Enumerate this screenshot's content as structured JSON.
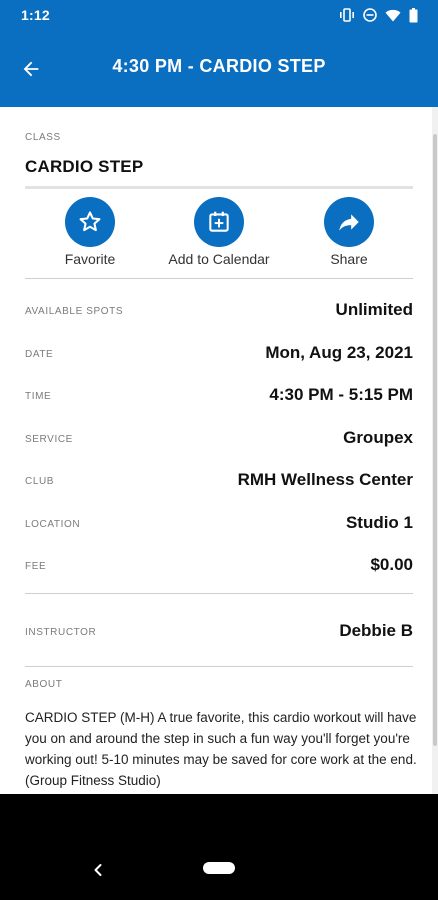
{
  "status_bar": {
    "time": "1:12",
    "icons": [
      "vibrate-icon",
      "do-not-disturb-icon",
      "wifi-icon",
      "battery-icon"
    ]
  },
  "app_bar": {
    "title": "4:30 PM - CARDIO STEP",
    "back_icon": "arrow-left-icon"
  },
  "class": {
    "label": "CLASS",
    "name": "CARDIO STEP"
  },
  "actions": [
    {
      "label": "Favorite",
      "icon": "star-outline-icon"
    },
    {
      "label": "Add to Calendar",
      "icon": "calendar-plus-icon"
    },
    {
      "label": "Share",
      "icon": "share-arrow-icon"
    }
  ],
  "details": [
    {
      "label": "AVAILABLE SPOTS",
      "value": "Unlimited"
    },
    {
      "label": "DATE",
      "value": "Mon, Aug 23, 2021"
    },
    {
      "label": "TIME",
      "value": "4:30 PM - 5:15 PM"
    },
    {
      "label": "SERVICE",
      "value": "Groupex"
    },
    {
      "label": "CLUB",
      "value": "RMH Wellness Center"
    },
    {
      "label": "LOCATION",
      "value": "Studio 1"
    },
    {
      "label": "FEE",
      "value": "$0.00"
    }
  ],
  "instructor": {
    "label": "INSTRUCTOR",
    "value": "Debbie B"
  },
  "about": {
    "label": "ABOUT",
    "text": "CARDIO STEP (M-H) A true favorite, this cardio workout will have you on and around the step in such a fun way you'll forget you're working out! 5-10 minutes may be saved for core work at the end. (Group Fitness Studio)"
  },
  "colors": {
    "primary": "#0a6fc1",
    "nav_bar": "#000000",
    "divider": "#cfcfcf"
  }
}
